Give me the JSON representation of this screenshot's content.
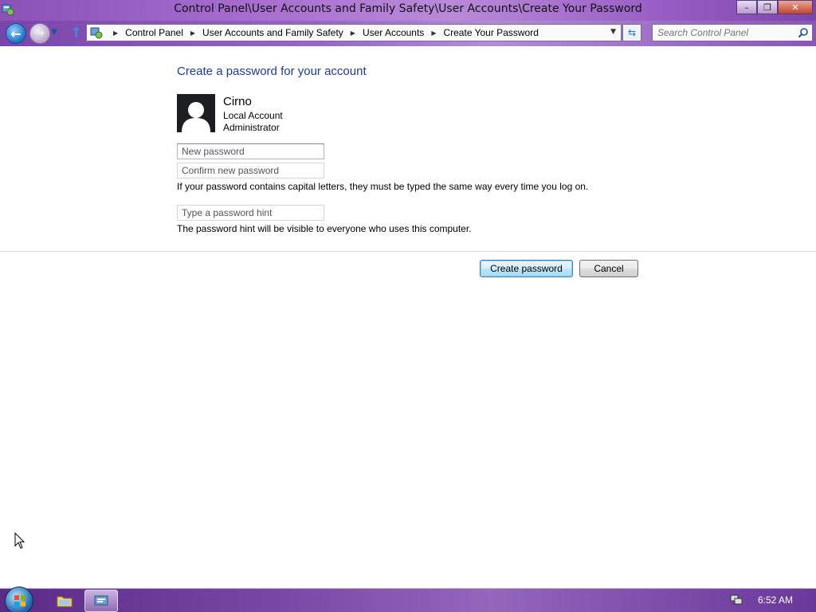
{
  "window": {
    "title": "Control Panel\\User Accounts and Family Safety\\User Accounts\\Create Your Password",
    "minimize_glyph": "–",
    "restore_glyph": "❐",
    "close_glyph": "✕"
  },
  "nav": {
    "breadcrumbs": [
      "Control Panel",
      "User Accounts and Family Safety",
      "User Accounts",
      "Create Your Password"
    ],
    "search_placeholder": "Search Control Panel"
  },
  "main": {
    "heading": "Create a password for your account",
    "user": {
      "name": "Cirno",
      "account_type": "Local Account",
      "role": "Administrator"
    },
    "fields": {
      "new_password_placeholder": "New password",
      "confirm_password_placeholder": "Confirm new password",
      "hint_placeholder": "Type a password hint"
    },
    "capital_letters_note": "If your password contains capital letters, they must be typed the same way every time you log on.",
    "hint_note": "The password hint will be visible to everyone who uses this computer.",
    "buttons": {
      "create": "Create password",
      "cancel": "Cancel"
    }
  },
  "taskbar": {
    "clock": "6:52 AM"
  },
  "colors": {
    "heading": "#1e3c8c",
    "titlebar": "#a66ccf",
    "taskbar": "#7a48a6"
  }
}
